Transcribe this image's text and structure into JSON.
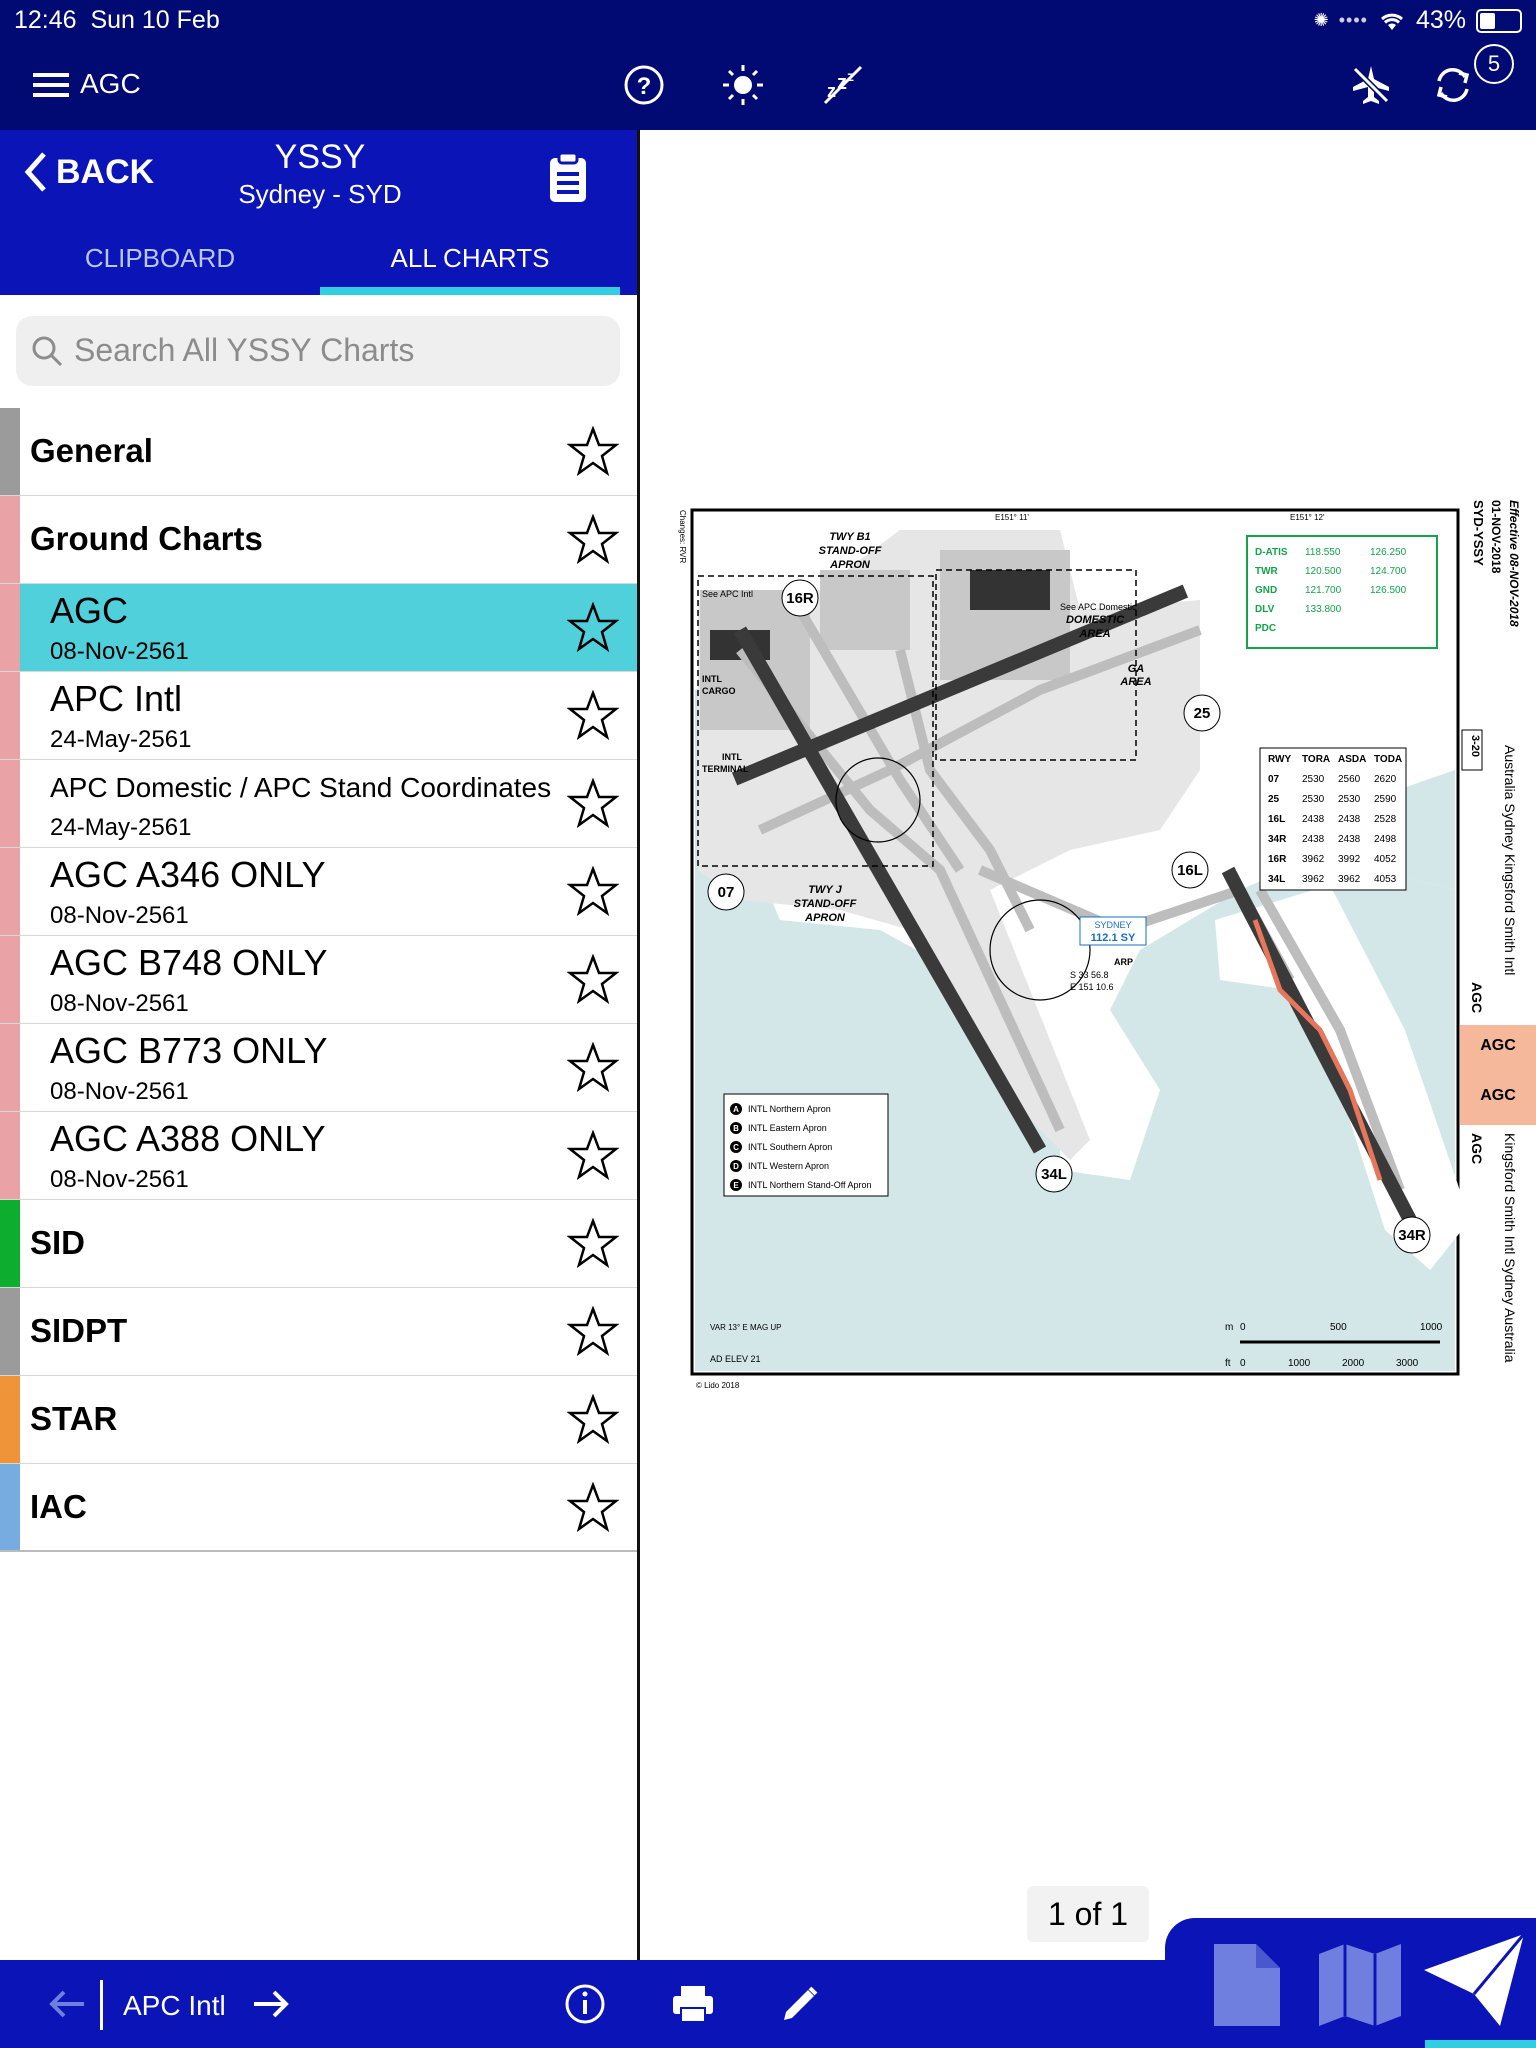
{
  "status_bar": {
    "time": "12:46",
    "date": "Sun 10 Feb",
    "battery": "43%",
    "battery_level": 0.43
  },
  "toolbar": {
    "title": "AGC",
    "sync_badge": "5"
  },
  "header": {
    "back_label": "BACK",
    "station_code": "YSSY",
    "station_name": "Sydney - SYD"
  },
  "tabs": [
    {
      "label": "CLIPBOARD",
      "active": false
    },
    {
      "label": "ALL CHARTS",
      "active": true
    }
  ],
  "search": {
    "placeholder": "Search All YSSY Charts"
  },
  "sections": [
    {
      "label": "General",
      "color": "#9b9b9b"
    },
    {
      "label": "Ground Charts",
      "color": "#e9a2a6"
    },
    {
      "label": "SID",
      "color": "#0dad2f"
    },
    {
      "label": "SIDPT",
      "color": "#9b9b9b"
    },
    {
      "label": "STAR",
      "color": "#ef9438"
    },
    {
      "label": "IAC",
      "color": "#76ace0"
    }
  ],
  "charts": [
    {
      "title": "AGC",
      "date": "08-Nov-2561",
      "selected": true
    },
    {
      "title": "APC Intl",
      "date": "24-May-2561"
    },
    {
      "title": "APC Domestic / APC Stand Coordinates",
      "date": "24-May-2561"
    },
    {
      "title": "AGC A346 ONLY",
      "date": "08-Nov-2561"
    },
    {
      "title": "AGC B748 ONLY",
      "date": "08-Nov-2561"
    },
    {
      "title": "AGC B773 ONLY",
      "date": "08-Nov-2561"
    },
    {
      "title": "AGC A388 ONLY",
      "date": "08-Nov-2561"
    }
  ],
  "chart_view": {
    "page_indicator": "1 of 1",
    "effective": "Effective 08-NOV-2018",
    "issue_date": "01-NOV-2018",
    "airport_id": "SYD-YSSY",
    "side_title": "Australia Sydney Kingsford Smith Intl",
    "side_title_bottom": "Kingsford Smith Intl Sydney Australia",
    "tag_top": "AGC",
    "tag_mid1": "AGC",
    "tag_mid2": "AGC",
    "tag_bottom": "AGC",
    "page_ref": "3-20",
    "changes": "Changes: RVR",
    "copyright": "© Lido 2018",
    "var_label": "VAR 13° E MAG UP",
    "elev_label": "AD ELEV 21",
    "coord_top": "E151° 11'",
    "coord_top2": "E151° 12'",
    "frequencies": [
      {
        "name": "D-ATIS",
        "value": "118.550",
        "value2": "126.250"
      },
      {
        "name": "TWR",
        "value": "120.500",
        "value2": "124.700"
      },
      {
        "name": "GND",
        "value": "121.700",
        "value2": "126.500"
      },
      {
        "name": "DLV",
        "value": "133.800",
        "value2": ""
      },
      {
        "name": "PDC",
        "value": "",
        "value2": ""
      }
    ],
    "runway_table": {
      "headers": [
        "RWY",
        "TORA",
        "ASDA",
        "TODA"
      ],
      "rows": [
        [
          "07",
          "2530",
          "2560",
          "2620"
        ],
        [
          "25",
          "2530",
          "2530",
          "2590"
        ],
        [
          "16L",
          "2438",
          "2438",
          "2528"
        ],
        [
          "34R",
          "2438",
          "2438",
          "2498"
        ],
        [
          "16R",
          "3962",
          "3992",
          "4052"
        ],
        [
          "34L",
          "3962",
          "3962",
          "4053"
        ]
      ]
    },
    "apron_legend": [
      {
        "key": "A",
        "label": "INTL Northern Apron"
      },
      {
        "key": "B",
        "label": "INTL Eastern Apron"
      },
      {
        "key": "C",
        "label": "INTL Southern Apron"
      },
      {
        "key": "D",
        "label": "INTL Western Apron"
      },
      {
        "key": "E",
        "label": "INTL Northern Stand-Off Apron"
      }
    ],
    "runway_labels": {
      "r16R": "16R",
      "r34L": "34L",
      "r16L": "16L",
      "r34R": "34R",
      "r07": "07",
      "r25": "25"
    },
    "area_labels": {
      "twy_b1": "TWY B1",
      "standoff": "STAND-OFF",
      "apron": "APRON",
      "domestic": "DOMESTIC",
      "area": "AREA",
      "twy_j": "TWY J",
      "standoff2": "STAND-OFF",
      "apron2": "APRON",
      "intl_terminal": "INTL",
      "terminal": "TERMINAL",
      "intl_cargo": "INTL",
      "cargo": "CARGO",
      "ga": "GA",
      "ga_area": "AREA",
      "see_apc_intl": "See APC Intl",
      "see_apc_dom": "See APC Domestic",
      "vor_name": "SYDNEY",
      "vor_freq": "112.1 SY",
      "arp": "ARP",
      "arp_s": "S 33 56.8",
      "arp_e": "E 151 10.6"
    },
    "scale": {
      "m": "m",
      "ft": "ft",
      "m_ticks": [
        "0",
        "500",
        "1000"
      ],
      "ft_ticks": [
        "0",
        "1000",
        "2000",
        "3000"
      ]
    }
  },
  "bottom_bar": {
    "current_chart": "APC Intl"
  },
  "colors": {
    "navy": "#010a73",
    "blue": "#0b14b6",
    "accent": "#33cde0",
    "selected_row": "#50d0da",
    "water": "#d3e7e8",
    "runway": "#3a3a3a",
    "taxiway": "#bdbdbd"
  }
}
